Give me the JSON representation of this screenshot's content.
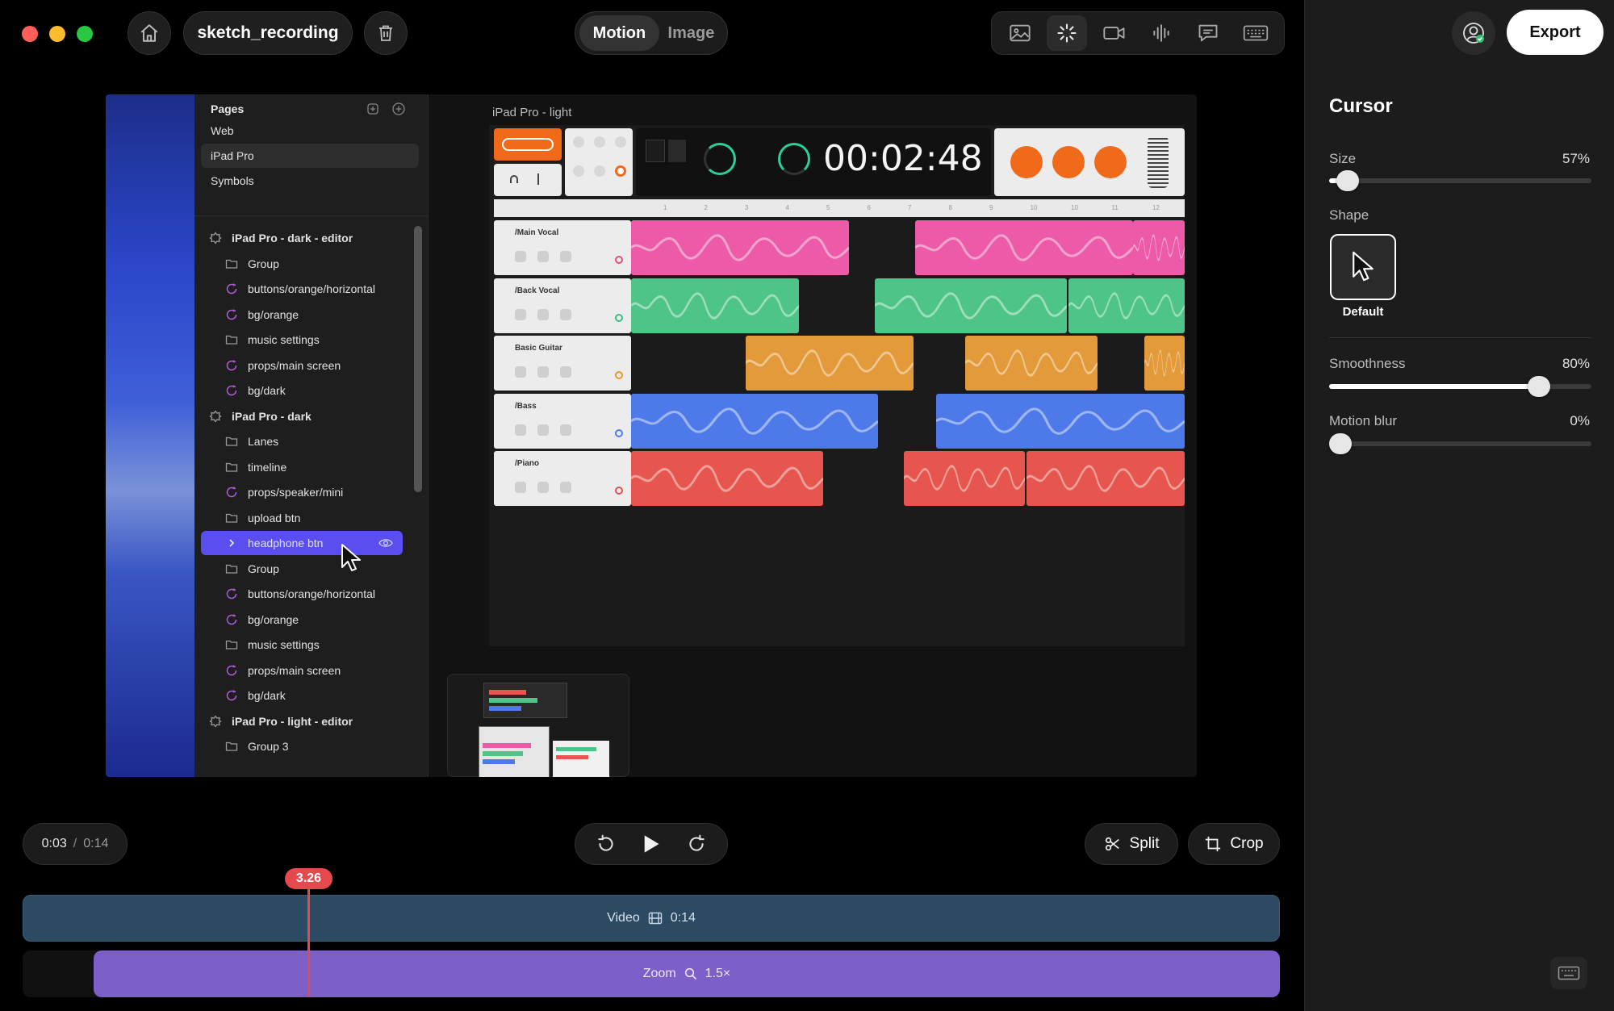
{
  "window": {
    "project_name": "sketch_recording"
  },
  "mode_toggle": {
    "active": "Motion",
    "inactive": "Image"
  },
  "toolbar": {
    "tools": [
      "image-icon",
      "cursor-click-icon",
      "camera-icon",
      "audio-waveform-icon",
      "caption-icon",
      "keyboard-icon"
    ],
    "active_tool": "cursor-click-icon"
  },
  "export": {
    "label": "Export"
  },
  "cursor_panel": {
    "title": "Cursor",
    "size": {
      "label": "Size",
      "value": "57%",
      "level": 0.07
    },
    "shape": {
      "label": "Shape",
      "option": "Default"
    },
    "smoothness": {
      "label": "Smoothness",
      "value": "80%",
      "level": 0.8
    },
    "motion_blur": {
      "label": "Motion blur",
      "value": "0%",
      "level": 0
    }
  },
  "preview": {
    "pages_title": "Pages",
    "pages": [
      "Web",
      "iPad Pro",
      "Symbols"
    ],
    "selected_page": "iPad Pro",
    "layers": [
      {
        "label": "iPad Pro - dark - editor",
        "level": 0,
        "icon": "component"
      },
      {
        "label": "Group",
        "level": 1,
        "icon": "folder"
      },
      {
        "label": "buttons/orange/horizontal",
        "level": 1,
        "icon": "symbol"
      },
      {
        "label": "bg/orange",
        "level": 1,
        "icon": "symbol"
      },
      {
        "label": "music settings",
        "level": 1,
        "icon": "folder"
      },
      {
        "label": "props/main screen",
        "level": 1,
        "icon": "symbol"
      },
      {
        "label": "bg/dark",
        "level": 1,
        "icon": "symbol"
      },
      {
        "label": "iPad Pro - dark",
        "level": 0,
        "icon": "component"
      },
      {
        "label": "Lanes",
        "level": 1,
        "icon": "folder"
      },
      {
        "label": "timeline",
        "level": 1,
        "icon": "folder"
      },
      {
        "label": "props/speaker/mini",
        "level": 1,
        "icon": "symbol"
      },
      {
        "label": "upload btn",
        "level": 1,
        "icon": "folder"
      },
      {
        "label": "headphone btn",
        "level": 1,
        "icon": "chevron",
        "selected": true
      },
      {
        "label": "Group",
        "level": 1,
        "icon": "folder"
      },
      {
        "label": "buttons/orange/horizontal",
        "level": 1,
        "icon": "symbol"
      },
      {
        "label": "bg/orange",
        "level": 1,
        "icon": "symbol"
      },
      {
        "label": "music settings",
        "level": 1,
        "icon": "folder"
      },
      {
        "label": "props/main screen",
        "level": 1,
        "icon": "symbol"
      },
      {
        "label": "bg/dark",
        "level": 1,
        "icon": "symbol"
      },
      {
        "label": "iPad Pro - light - editor",
        "level": 0,
        "icon": "component"
      },
      {
        "label": "Group 3",
        "level": 1,
        "icon": "folder"
      }
    ],
    "frame_label": "iPad Pro - light",
    "clock": "00:02:48",
    "ruler_marks": [
      "1",
      "2",
      "3",
      "4",
      "5",
      "6",
      "7",
      "8",
      "9",
      "10",
      "10",
      "11",
      "12"
    ],
    "tracks": [
      {
        "name": "/Main Vocal",
        "color": "#ec5aa8",
        "dot": "#e0507a"
      },
      {
        "name": "/Back Vocal",
        "color": "#4ec488",
        "dot": "#3ebf82"
      },
      {
        "name": "Basic Guitar",
        "color": "#e39a3a",
        "dot": "#e89a2a"
      },
      {
        "name": "/Bass",
        "color": "#4d7ae8",
        "dot": "#4b7cf0"
      },
      {
        "name": "/Piano",
        "color": "#e6564e",
        "dot": "#e65050"
      }
    ]
  },
  "transport": {
    "current_time": "0:03",
    "separator": "/",
    "total_time": "0:14",
    "split_label": "Split",
    "crop_label": "Crop"
  },
  "timeline": {
    "playhead_label": "3.26",
    "video_label": "Video",
    "video_duration": "0:14",
    "zoom_label": "Zoom",
    "zoom_value": "1.5×"
  },
  "colors": {
    "accent": "#5a4ef0",
    "playhead": "#e5484d",
    "video_track": "#2d4a63",
    "zoom_track": "#7d5fc9",
    "orange": "#f06a1a"
  }
}
